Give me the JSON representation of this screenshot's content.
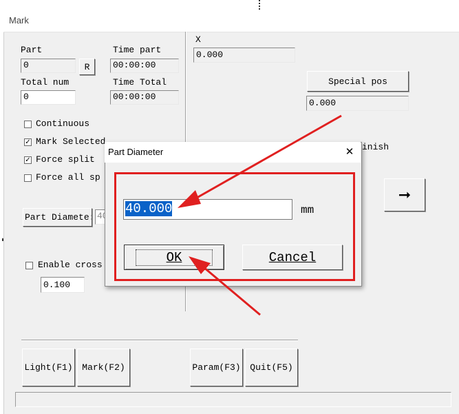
{
  "window": {
    "title": "Mark"
  },
  "left": {
    "part_label": "Part",
    "part_value": "0",
    "reset_label": "R",
    "time_part_label": "Time part",
    "time_part_value": "00:00:00",
    "total_num_label": "Total num",
    "total_num_value": "0",
    "time_total_label": "Time Total",
    "time_total_value": "00:00:00",
    "checkboxes": [
      {
        "label": "Continuous",
        "checked": false
      },
      {
        "label": "Mark Selected",
        "checked": true
      },
      {
        "label": "Force split",
        "checked": true
      },
      {
        "label": "Force all sp",
        "checked": false
      }
    ],
    "part_diameter_button": "Part Diamete:",
    "part_diameter_value": "40",
    "enable_cross_label": "Enable cross",
    "enable_cross_value": "0.100"
  },
  "right": {
    "x_label": "X",
    "x_value": "0.000",
    "special_pos_button": "Special pos",
    "special_pos_value": "0.000",
    "finish_label": "inish",
    "arrow_button_symbol": "➞"
  },
  "bottom": {
    "light_button": "Light(F1)",
    "mark_button": "Mark(F2)",
    "param_button": "Param(F3)",
    "quit_button": "Quit(F5)"
  },
  "dialog": {
    "title": "Part Diameter",
    "close_symbol": "✕",
    "diameter_value": "40.000",
    "unit": "mm",
    "ok_button": "OK",
    "cancel_button": "Cancel"
  },
  "annotation_color": "#e02020"
}
